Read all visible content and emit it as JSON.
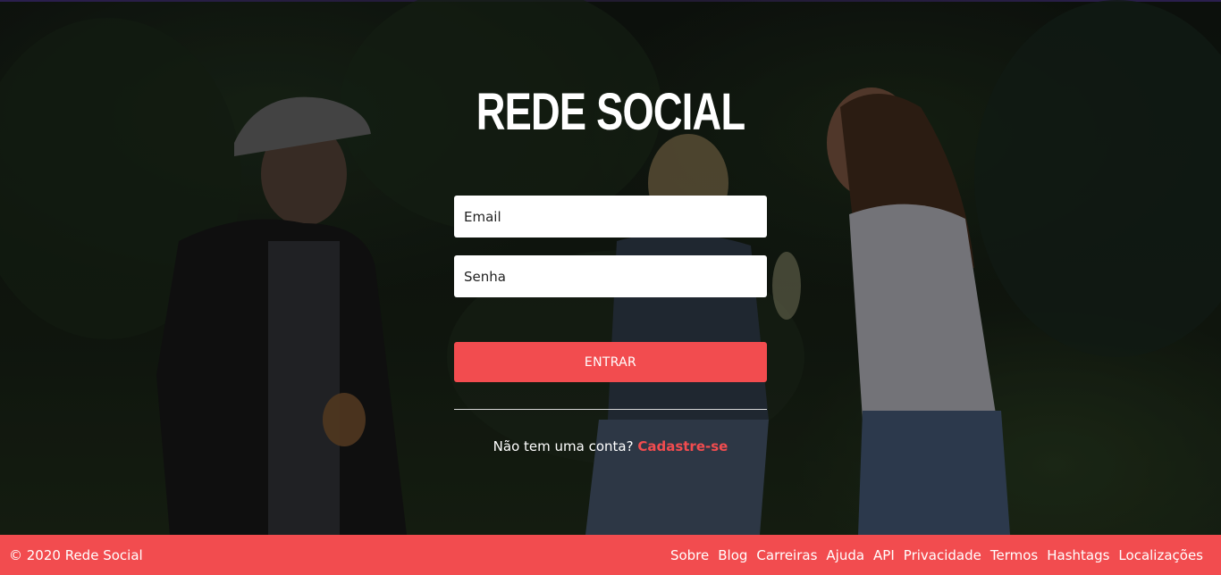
{
  "brand": {
    "title": "REDE SOCIAL"
  },
  "login": {
    "email_placeholder": "Email",
    "password_placeholder": "Senha",
    "submit_label": "ENTRAR"
  },
  "signup": {
    "prompt": "Não tem uma conta?",
    "link_label": "Cadastre-se"
  },
  "footer": {
    "copyright": "© 2020 Rede Social",
    "links": [
      "Sobre",
      "Blog",
      "Carreiras",
      "Ajuda",
      "API",
      "Privacidade",
      "Termos",
      "Hashtags",
      "Localizações"
    ]
  },
  "colors": {
    "accent": "#f24c4f",
    "footer_bg": "#f24c4f",
    "text_light": "#ffffff"
  }
}
